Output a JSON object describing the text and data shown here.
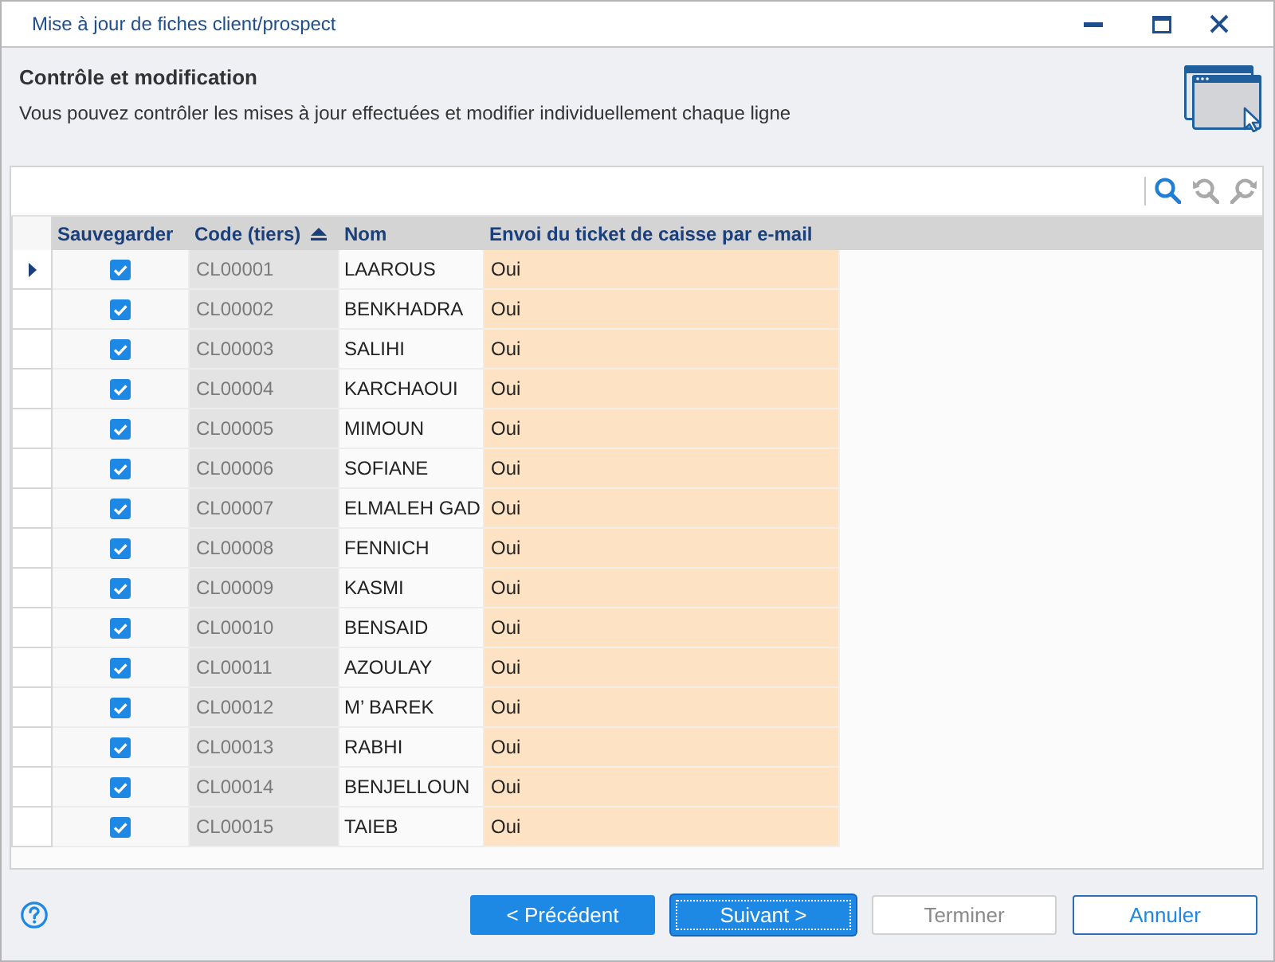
{
  "window": {
    "title": "Mise à jour de fiches client/prospect"
  },
  "header": {
    "title": "Contrôle et modification",
    "description": "Vous pouvez contrôler les mises à jour effectuées et modifier individuellement chaque ligne"
  },
  "toolbar": [
    {
      "kind": "search",
      "disabled": false
    },
    {
      "kind": "find-previous",
      "disabled": true
    },
    {
      "kind": "find-next",
      "disabled": true
    }
  ],
  "table": {
    "columns": [
      {
        "label": "Sauvegarder",
        "sorted": false
      },
      {
        "label": "Code (tiers)",
        "sorted": true
      },
      {
        "label": "Nom",
        "sorted": false
      },
      {
        "label": "Envoi du ticket de caisse par e-mail",
        "sorted": false
      }
    ],
    "rows": [
      {
        "current": true,
        "checked": true,
        "code": "CL00001",
        "name": "LAAROUS",
        "email_receipt": "Oui"
      },
      {
        "current": false,
        "checked": true,
        "code": "CL00002",
        "name": "BENKHADRA",
        "email_receipt": "Oui"
      },
      {
        "current": false,
        "checked": true,
        "code": "CL00003",
        "name": "SALIHI",
        "email_receipt": "Oui"
      },
      {
        "current": false,
        "checked": true,
        "code": "CL00004",
        "name": "KARCHAOUI",
        "email_receipt": "Oui"
      },
      {
        "current": false,
        "checked": true,
        "code": "CL00005",
        "name": "MIMOUN",
        "email_receipt": "Oui"
      },
      {
        "current": false,
        "checked": true,
        "code": "CL00006",
        "name": "SOFIANE",
        "email_receipt": "Oui"
      },
      {
        "current": false,
        "checked": true,
        "code": "CL00007",
        "name": "ELMALEH GAD",
        "email_receipt": "Oui"
      },
      {
        "current": false,
        "checked": true,
        "code": "CL00008",
        "name": "FENNICH",
        "email_receipt": "Oui"
      },
      {
        "current": false,
        "checked": true,
        "code": "CL00009",
        "name": "KASMI",
        "email_receipt": "Oui"
      },
      {
        "current": false,
        "checked": true,
        "code": "CL00010",
        "name": "BENSAID",
        "email_receipt": "Oui"
      },
      {
        "current": false,
        "checked": true,
        "code": "CL00011",
        "name": "AZOULAY",
        "email_receipt": "Oui"
      },
      {
        "current": false,
        "checked": true,
        "code": "CL00012",
        "name": "M’ BAREK",
        "email_receipt": "Oui"
      },
      {
        "current": false,
        "checked": true,
        "code": "CL00013",
        "name": "RABHI",
        "email_receipt": "Oui"
      },
      {
        "current": false,
        "checked": true,
        "code": "CL00014",
        "name": "BENJELLOUN",
        "email_receipt": "Oui"
      },
      {
        "current": false,
        "checked": true,
        "code": "CL00015",
        "name": "TAIEB",
        "email_receipt": "Oui"
      }
    ]
  },
  "buttons": [
    {
      "label": "< Précédent",
      "kind": "primary",
      "focused": false,
      "disabled": false
    },
    {
      "label": "Suivant >",
      "kind": "primary",
      "focused": true,
      "disabled": false
    },
    {
      "label": "Terminer",
      "kind": "secondary",
      "focused": false,
      "disabled": true
    },
    {
      "label": "Annuler",
      "kind": "secondary",
      "focused": false,
      "disabled": false
    }
  ]
}
